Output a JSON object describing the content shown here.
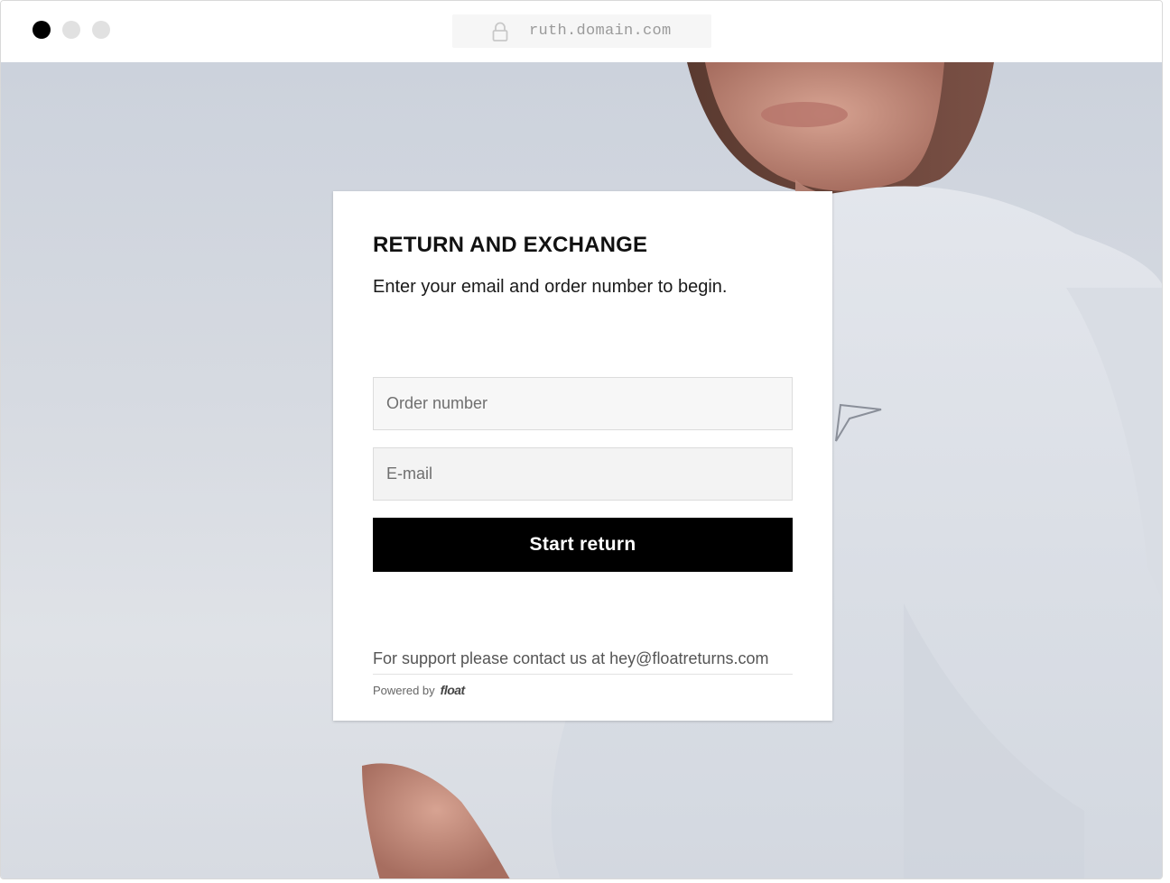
{
  "browser": {
    "url": "ruth.domain.com",
    "lock_icon": "lock-icon",
    "window_controls": [
      "close",
      "minimize",
      "maximize"
    ]
  },
  "form": {
    "title": "RETURN AND EXCHANGE",
    "subtitle": "Enter your email and order number to begin.",
    "order_placeholder": "Order number",
    "email_placeholder": "E-mail",
    "submit_label": "Start return",
    "support_text": "For support please contact us at hey@floatreturns.com",
    "powered_by": "Powered by",
    "brand": "float"
  },
  "colors": {
    "button_bg": "#000000",
    "button_text": "#ffffff",
    "active_dot": "#000000",
    "inactive_dot": "#e1e1e1"
  }
}
